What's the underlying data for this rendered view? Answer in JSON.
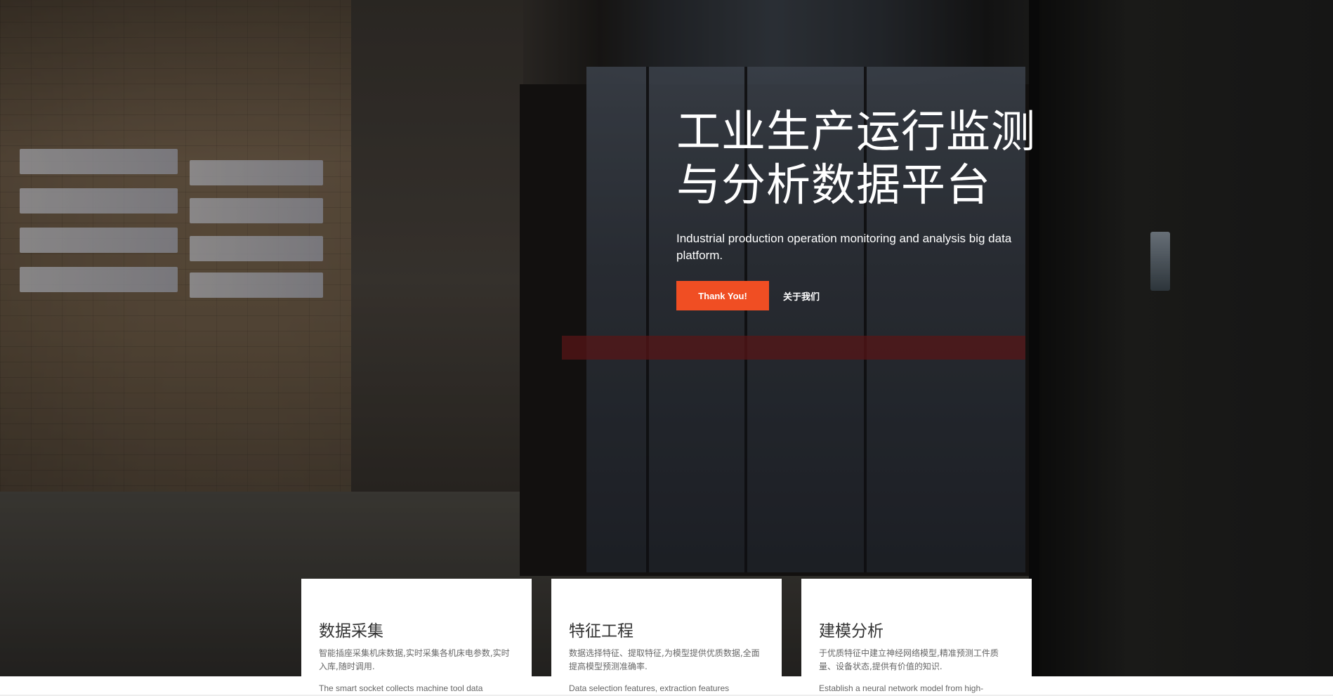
{
  "hero": {
    "title_line1": "工业生产运行监测",
    "title_line2": "与分析数据平台",
    "subtitle": "Industrial production operation monitoring and analysis big data platform.",
    "primary_button": "Thank You!",
    "secondary_link": "关于我们",
    "accent_color": "#f04e23"
  },
  "features": [
    {
      "title": "数据采集",
      "desc": "智能插座采集机床数据,实时采集各机床电参数,实时入库,随时调用.",
      "en": "The smart socket collects machine tool data"
    },
    {
      "title": "特征工程",
      "desc": "数据选择特征、提取特征,为模型提供优质数据,全面提高模型预测准确率.",
      "en": "Data selection features, extraction features"
    },
    {
      "title": "建模分析",
      "desc": "于优质特征中建立神经网络模型,精准预测工件质量、设备状态,提供有价值的知识.",
      "en": "Establish a neural network model from high-"
    }
  ]
}
